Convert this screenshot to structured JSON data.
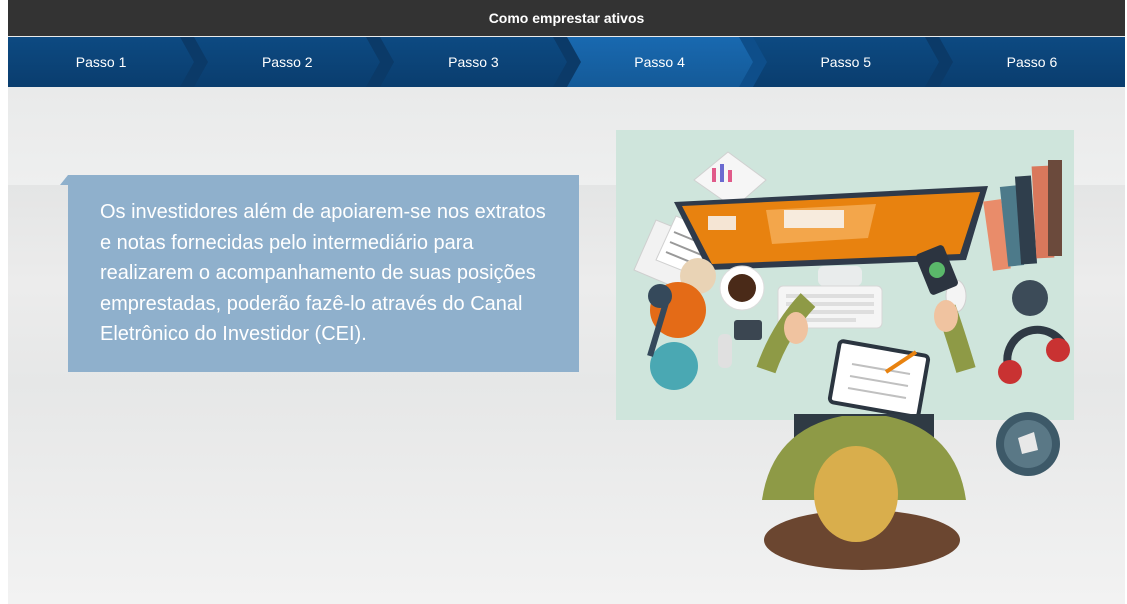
{
  "title": "Como emprestar ativos",
  "steps": [
    {
      "label": "Passo 1"
    },
    {
      "label": "Passo 2"
    },
    {
      "label": "Passo 3"
    },
    {
      "label": "Passo 4",
      "active": true
    },
    {
      "label": "Passo 5"
    },
    {
      "label": "Passo 6"
    }
  ],
  "content": {
    "paragraph": "Os investidores além de apoiarem-se nos extratos e notas fornecidas pelo intermediário para realizarem o acompanhamento de suas posições emprestadas, poderão fazê-lo através do Canal Eletrônico do Investidor (CEI)."
  },
  "colors": {
    "titlebar": "#333333",
    "step_bar": "#0a3d6e",
    "step_active": "#1969b0",
    "text_box": "#8fb0cc",
    "illustration_bg": "#cfe5dc"
  }
}
